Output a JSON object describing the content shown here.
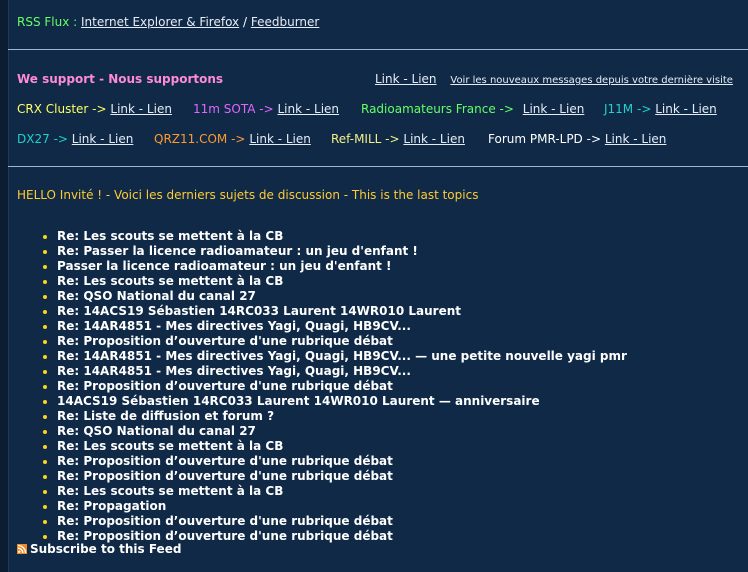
{
  "rss": {
    "label": "RSS Flux :",
    "link1": "Internet Explorer & Firefox",
    "sep": "/",
    "link2": "Feedburner"
  },
  "support": {
    "title": "We support - Nous supportons",
    "link": "Link - Lien",
    "new_messages": "Voir les nouveaux messages depuis votre dernière visite"
  },
  "partners_row1": [
    {
      "name": "CRX Cluster",
      "arrow": "->",
      "link": "Link - Lien"
    },
    {
      "name": "11m SOTA",
      "arrow": "->",
      "link": "Link - Lien"
    },
    {
      "name": "Radioamateurs France",
      "arrow": "->",
      "link": "Link - Lien"
    },
    {
      "name": "J11M",
      "arrow": "->",
      "link": "Link - Lien"
    }
  ],
  "partners_row2": [
    {
      "name": "DX27",
      "arrow": "->",
      "link": "Link - Lien"
    },
    {
      "name": "QRZ11.COM",
      "arrow": "->",
      "link": "Link - Lien"
    },
    {
      "name": "Ref-MILL",
      "arrow": "->",
      "link": "Link - Lien"
    },
    {
      "name": "Forum PMR-LPD",
      "arrow": "->",
      "link": "Link - Lien"
    }
  ],
  "hello": "HELLO Invité ! - Voici les derniers sujets de discussion - This is the last topics",
  "topics": [
    "Re: Les scouts se mettent à la CB",
    "Re: Passer la licence radioamateur : un jeu d'enfant !",
    "Passer la licence radioamateur : un jeu d'enfant !",
    "Re: Les scouts se mettent à la CB",
    "Re: QSO National du canal 27",
    "Re: 14ACS19 Sébastien 14RC033 Laurent 14WR010 Laurent",
    "Re: 14AR4851 - Mes directives Yagi, Quagi, HB9CV...",
    "Re: Proposition d’ouverture d'une rubrique débat",
    "Re: 14AR4851 - Mes directives Yagi, Quagi, HB9CV... — une petite nouvelle yagi pmr",
    "Re: 14AR4851 - Mes directives Yagi, Quagi, HB9CV...",
    "Re: Proposition d’ouverture d'une rubrique débat",
    "14ACS19 Sébastien 14RC033 Laurent 14WR010 Laurent — anniversaire",
    "Re: Liste de diffusion et forum ?",
    "Re: QSO National du canal 27",
    "Re: Les scouts se mettent à la CB",
    "Re: Proposition d’ouverture d'une rubrique débat",
    "Re: Proposition d’ouverture d'une rubrique débat",
    "Re: Les scouts se mettent à la CB",
    "Re: Propagation",
    "Re: Proposition d’ouverture d'une rubrique débat",
    "Re: Proposition d’ouverture d'une rubrique débat"
  ],
  "subscribe": "Subscribe to this Feed",
  "colors": {
    "background": "#0f2947",
    "green": "#66ff66",
    "pink": "#ff8ad8",
    "yellow": "#ffff66",
    "gold": "#ffcc33",
    "cyan": "#22d0cc",
    "orange": "#ff9a33"
  }
}
